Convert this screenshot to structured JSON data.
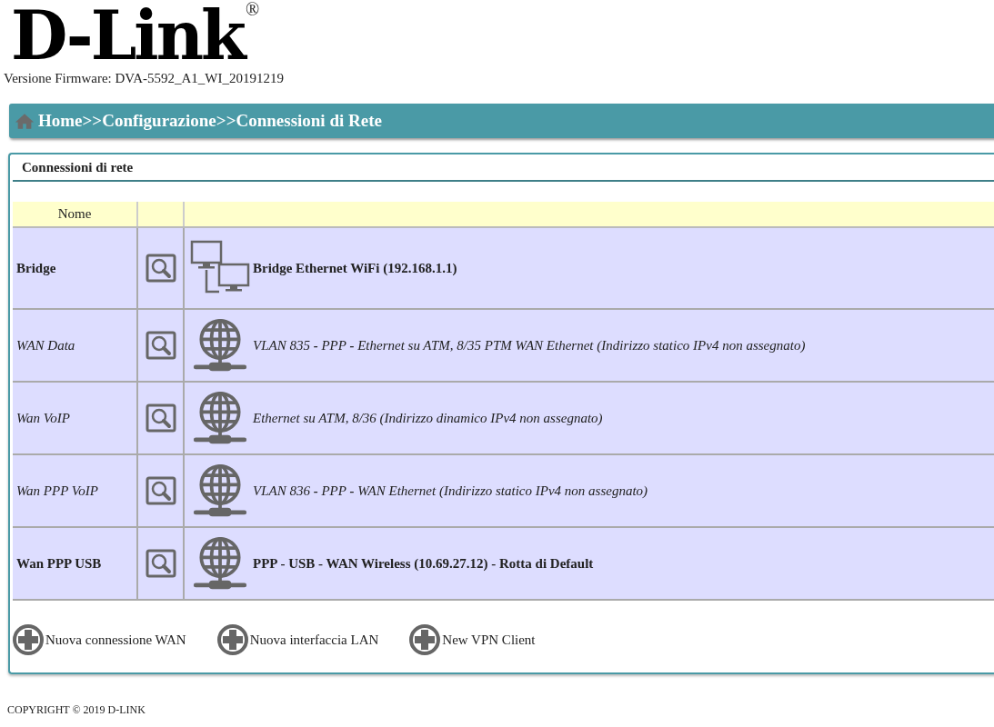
{
  "logo": {
    "brand": "D-Link",
    "registered": "®"
  },
  "firmware": "Versione Firmware: DVA-5592_A1_WI_20191219",
  "breadcrumb": "Home>>Configurazione>>Connessioni di Rete",
  "panel": {
    "title": "Connessioni di rete",
    "table": {
      "columns": [
        "Nome"
      ],
      "rows": [
        {
          "name": "Bridge",
          "active": true,
          "kind": "lan",
          "description": "Bridge Ethernet WiFi (192.168.1.1)"
        },
        {
          "name": "WAN Data",
          "active": false,
          "kind": "globe",
          "description": "VLAN 835 **-** PPP **-** Ethernet su ATM, 8/35 PTM WAN Ethernet (Indirizzo statico IPv4 non assegnato)"
        },
        {
          "name": "Wan VoIP",
          "active": false,
          "kind": "globe",
          "description": "Ethernet su ATM, 8/36 (Indirizzo dinamico IPv4 non assegnato)"
        },
        {
          "name": "Wan PPP VoIP",
          "active": false,
          "kind": "globe",
          "description": "VLAN 836 **-** PPP **-** WAN Ethernet (Indirizzo statico IPv4 non assegnato)"
        },
        {
          "name": "Wan PPP USB",
          "active": true,
          "kind": "globe",
          "description": "PPP - USB - WAN Wireless (10.69.27.12) - Rotta di Default"
        }
      ]
    },
    "actions": [
      "Nuova connessione WAN",
      "Nuova interfaccia LAN",
      "New VPN Client"
    ]
  },
  "copyright": "COPYRIGHT © 2019 D-LINK"
}
